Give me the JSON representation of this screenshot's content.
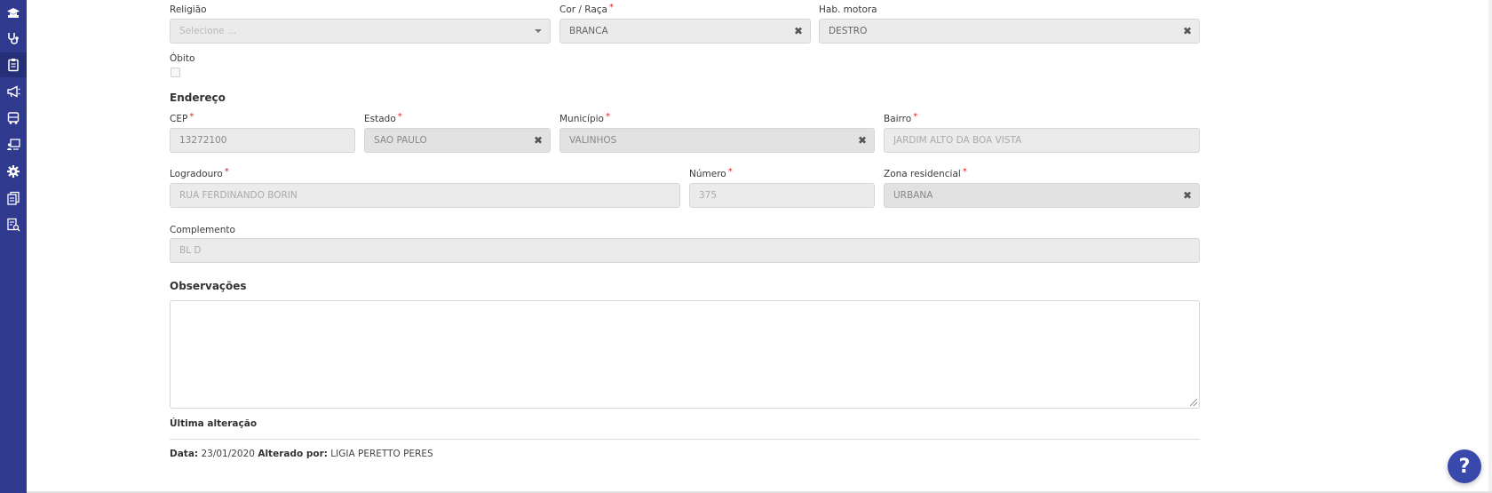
{
  "sidebar": {
    "items": [
      {
        "icon": "graduation-cap-icon"
      },
      {
        "icon": "stethoscope-icon"
      },
      {
        "icon": "clipboard-icon"
      },
      {
        "icon": "megaphone-icon"
      },
      {
        "icon": "bus-icon"
      },
      {
        "icon": "teacher-board-icon"
      },
      {
        "icon": "gear-icon"
      },
      {
        "icon": "documents-icon"
      },
      {
        "icon": "report-search-icon"
      }
    ]
  },
  "form": {
    "religiao": {
      "label": "Religião",
      "placeholder": "Selecione ..."
    },
    "cor_raca": {
      "label": "Cor / Raça",
      "value": "BRANCA"
    },
    "hab_motora": {
      "label": "Hab. motora",
      "value": "DESTRO"
    },
    "obito": {
      "label": "Óbito",
      "checked": false
    },
    "endereco_title": "Endereço",
    "cep": {
      "label": "CEP",
      "value": "13272100"
    },
    "estado": {
      "label": "Estado",
      "value": "SÃO PAULO"
    },
    "municipio": {
      "label": "Município",
      "value": "VALINHOS"
    },
    "bairro": {
      "label": "Bairro",
      "value": "JARDIM ALTO DA BOA VISTA"
    },
    "logradouro": {
      "label": "Logradouro",
      "value": "RUA FERDINANDO BORIN"
    },
    "numero": {
      "label": "Número",
      "value": "375"
    },
    "zona": {
      "label": "Zona residencial",
      "value": "URBANA"
    },
    "complemento": {
      "label": "Complemento",
      "value": "BL D"
    },
    "observacoes_title": "Observações",
    "ultima_title": "Última alteração",
    "required_mark": "*"
  },
  "footer": {
    "data_label": "Data:",
    "data_value": "23/01/2020",
    "alterado_label": "Alterado por:",
    "alterado_value": "LIGIA PERETTO PERES"
  },
  "help": {
    "label": "?"
  },
  "colors": {
    "sidebar": "#2f3a8f",
    "help_button": "#3949ab",
    "required": "#d9232d"
  }
}
